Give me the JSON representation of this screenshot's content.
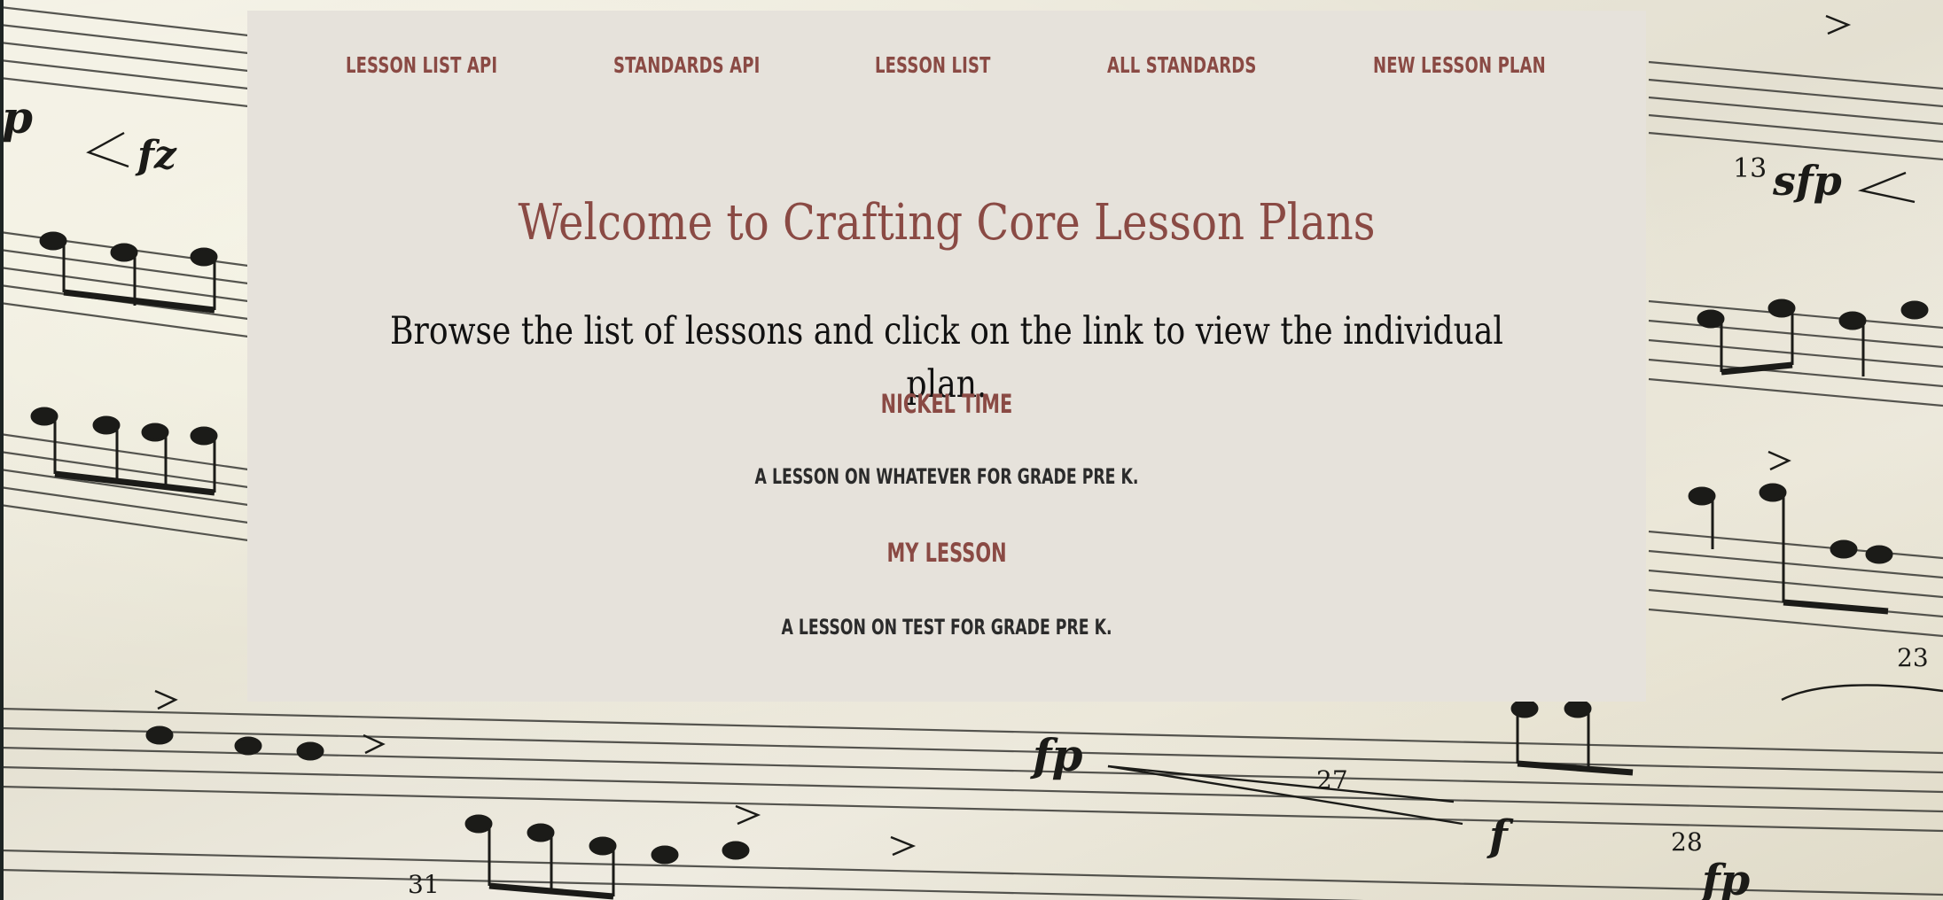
{
  "nav": {
    "items": [
      {
        "label": "Lesson List API"
      },
      {
        "label": "Standards API"
      },
      {
        "label": "Lesson List"
      },
      {
        "label": "All Standards"
      },
      {
        "label": "New Lesson Plan"
      }
    ]
  },
  "main": {
    "title": "Welcome to Crafting Core Lesson Plans",
    "subtitle": "Browse the list of lessons and click on the link to view the individual plan.",
    "lessons": [
      {
        "name": "Nickel Time",
        "description": "A lesson on whatever for grade Pre K."
      },
      {
        "name": "My Lesson",
        "description": "A lesson on test for grade Pre K."
      }
    ]
  },
  "background": {
    "printed_marks": [
      "p",
      "fz",
      "13",
      "sfp",
      "fp",
      "27",
      "f",
      "28",
      "fp",
      "31",
      "23"
    ]
  },
  "colors": {
    "accent": "#8a4a44",
    "card": "#e6e2db",
    "text": "#111111",
    "muted_text": "#2b2b2b"
  }
}
